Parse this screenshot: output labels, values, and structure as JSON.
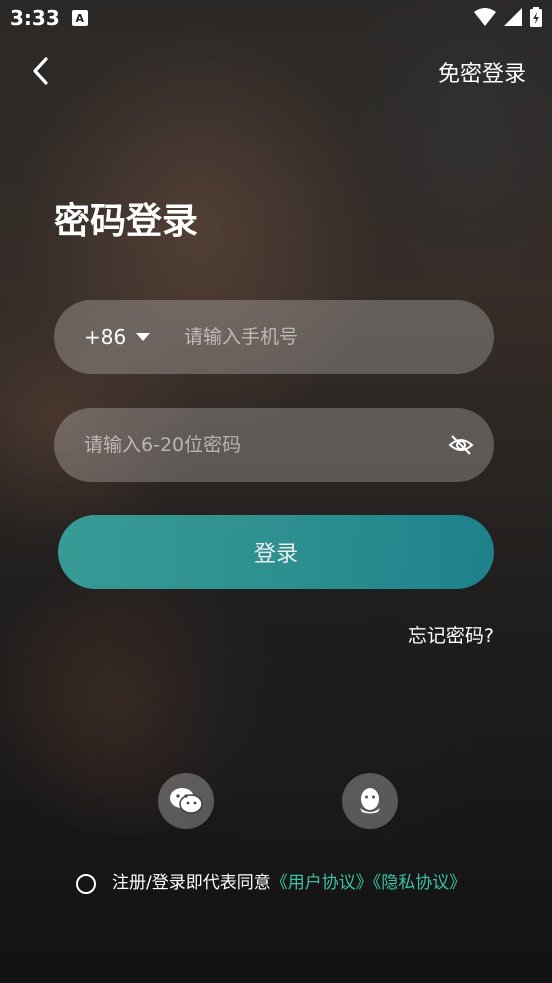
{
  "status_bar": {
    "time": "3:33",
    "notification_badge": "A"
  },
  "header": {
    "back_icon": "chevron-left-icon",
    "password_free_login": "免密登录"
  },
  "title": "密码登录",
  "phone": {
    "country_code": "+86",
    "placeholder": "请输入手机号"
  },
  "password": {
    "placeholder": "请输入6-20位密码",
    "visibility_icon": "eye-off-icon"
  },
  "login_button": "登录",
  "forgot_password": "忘记密码?",
  "social": {
    "wechat_icon": "wechat-icon",
    "qq_icon": "qq-icon"
  },
  "agreement": {
    "prefix": "注册/登录即代表同意",
    "user_agreement": "《用户协议》",
    "privacy_agreement": "《隐私协议》"
  },
  "colors": {
    "accent": "#3ec0a3",
    "button_start": "#3aa5a0",
    "button_end": "#1d8a95"
  }
}
